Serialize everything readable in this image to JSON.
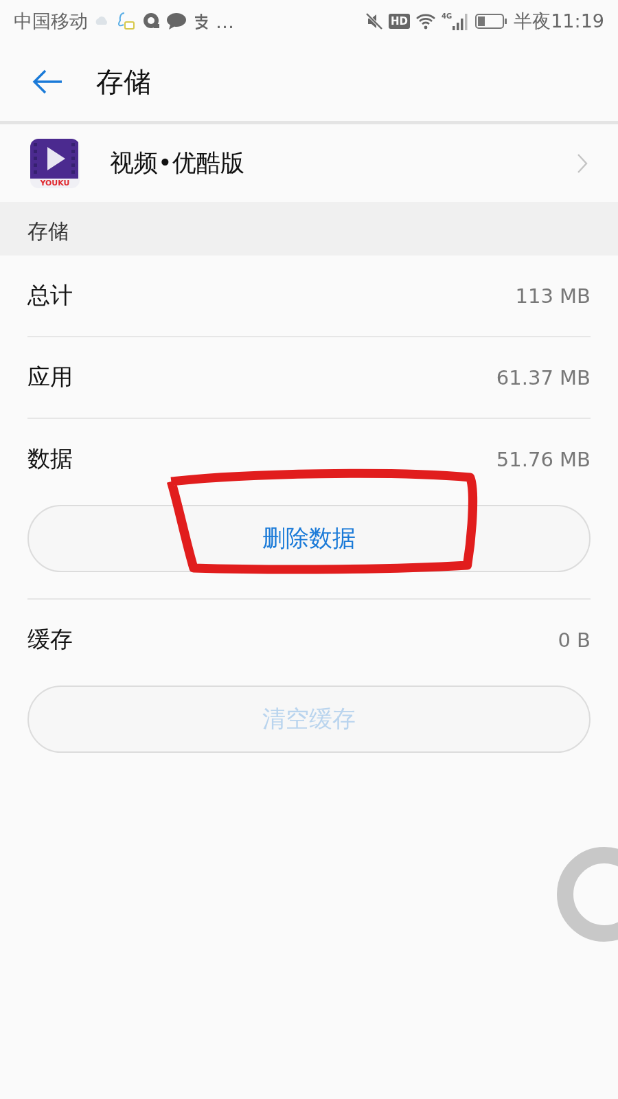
{
  "status_bar": {
    "carrier": "中国移动",
    "more": "…",
    "network_badge": "HD",
    "signal_label": "4G",
    "time": "半夜11:19"
  },
  "header": {
    "title": "存储"
  },
  "app": {
    "name": "视频•优酷版",
    "icon_label": "YOUKU"
  },
  "section": {
    "title": "存储"
  },
  "rows": [
    {
      "kind": "info",
      "label": "总计",
      "value": "113 MB"
    },
    {
      "kind": "info",
      "label": "应用",
      "value": "61.37 MB"
    },
    {
      "kind": "info",
      "label": "数据",
      "value": "51.76 MB"
    },
    {
      "kind": "button",
      "label": "删除数据",
      "disabled": false,
      "highlighted": true
    },
    {
      "kind": "info",
      "label": "缓存",
      "value": "0 B"
    },
    {
      "kind": "button",
      "label": "清空缓存",
      "disabled": true,
      "highlighted": false
    }
  ]
}
